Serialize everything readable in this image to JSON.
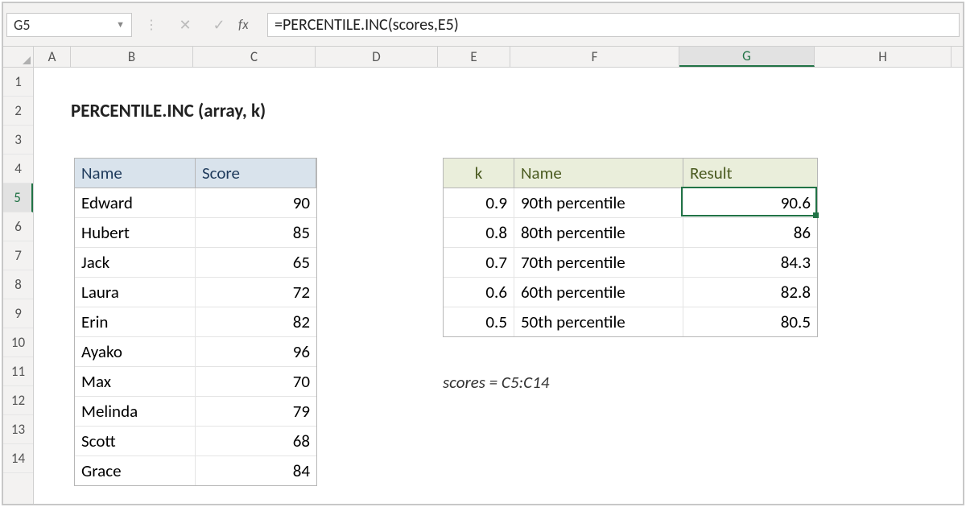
{
  "namebox": "G5",
  "formula": "=PERCENTILE.INC(scores,E5)",
  "columns": [
    "A",
    "B",
    "C",
    "D",
    "E",
    "F",
    "G",
    "H"
  ],
  "rows": [
    "1",
    "2",
    "3",
    "4",
    "5",
    "6",
    "7",
    "8",
    "9",
    "10",
    "11",
    "12",
    "13",
    "14"
  ],
  "selected_col": "G",
  "selected_row": "5",
  "title": "PERCENTILE.INC (array, k)",
  "table1": {
    "headers": {
      "name": "Name",
      "score": "Score"
    },
    "rows": [
      {
        "name": "Edward",
        "score": "90"
      },
      {
        "name": "Hubert",
        "score": "85"
      },
      {
        "name": "Jack",
        "score": "65"
      },
      {
        "name": "Laura",
        "score": "72"
      },
      {
        "name": "Erin",
        "score": "82"
      },
      {
        "name": "Ayako",
        "score": "96"
      },
      {
        "name": "Max",
        "score": "70"
      },
      {
        "name": "Melinda",
        "score": "79"
      },
      {
        "name": "Scott",
        "score": "68"
      },
      {
        "name": "Grace",
        "score": "84"
      }
    ]
  },
  "table2": {
    "headers": {
      "k": "k",
      "name": "Name",
      "result": "Result"
    },
    "rows": [
      {
        "k": "0.9",
        "name": "90th percentile",
        "result": "90.6"
      },
      {
        "k": "0.8",
        "name": "80th percentile",
        "result": "86"
      },
      {
        "k": "0.7",
        "name": "70th percentile",
        "result": "84.3"
      },
      {
        "k": "0.6",
        "name": "60th percentile",
        "result": "82.8"
      },
      {
        "k": "0.5",
        "name": "50th percentile",
        "result": "80.5"
      }
    ]
  },
  "note": "scores = C5:C14",
  "fx_label": "fx"
}
